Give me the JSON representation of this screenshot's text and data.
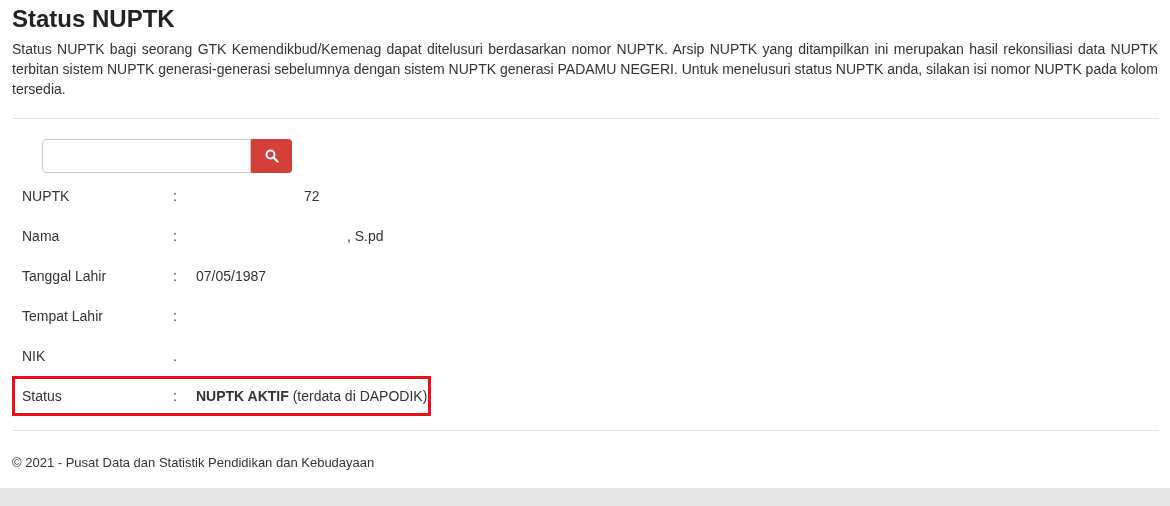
{
  "title": "Status NUPTK",
  "description": "Status NUPTK bagi seorang GTK Kemendikbud/Kemenag dapat ditelusuri berdasarkan nomor NUPTK. Arsip NUPTK yang ditampilkan ini merupakan hasil rekonsiliasi data NUPTK terbitan sistem NUPTK generasi-generasi sebelumnya dengan sistem NUPTK generasi PADAMU NEGERI. Untuk menelusuri status NUPTK anda, silakan isi nomor NUPTK pada kolom tersedia.",
  "rows": [
    {
      "label": "NUPTK",
      "separator": ":",
      "value": "72",
      "highlighted": false
    },
    {
      "label": "Nama",
      "separator": ":",
      "value": ", S.pd",
      "highlighted": false
    },
    {
      "label": "Tanggal Lahir",
      "separator": ":",
      "value": "07/05/1987",
      "highlighted": false
    },
    {
      "label": "Tempat Lahir",
      "separator": ":",
      "highlighted": false
    },
    {
      "label": "NIK",
      "separator": ".",
      "highlighted": false
    },
    {
      "label": "Status",
      "separator": ":",
      "value": "**NUPTK AKTIF** (terdata di DAPODIK)",
      "highlighted": true
    }
  ],
  "footer": "© 2021 - Pusat Data dan Statistik Pendidikan dan Kebudayaan"
}
